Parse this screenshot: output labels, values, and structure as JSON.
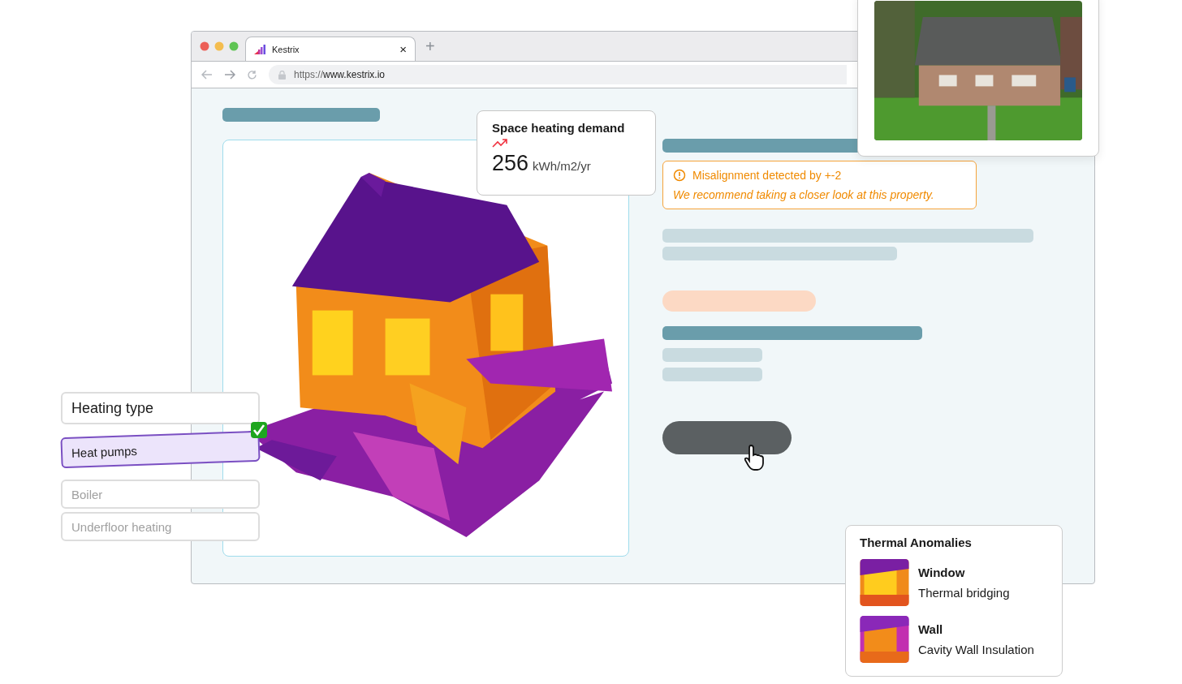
{
  "browser": {
    "tab": {
      "title": "Kestrix",
      "close": "×",
      "new_tab": "+",
      "selected": true
    },
    "url": {
      "scheme": "https://",
      "host": "www.kestrix.io"
    }
  },
  "metric": {
    "title": "Space heating demand",
    "value": "256",
    "unit": "kWh/m2/yr"
  },
  "alert": {
    "title": "Misalignment detected by +-2",
    "message": "We recommend taking a closer look at this property."
  },
  "heating": {
    "label": "Heating type",
    "options": [
      {
        "label": "Heat pumps",
        "selected": true
      },
      {
        "label": "Boiler",
        "selected": false
      },
      {
        "label": "Underfloor heating",
        "selected": false
      }
    ]
  },
  "anomalies": {
    "title": "Thermal Anomalies",
    "items": [
      {
        "name": "Window",
        "issue": "Thermal bridging"
      },
      {
        "name": "Wall",
        "issue": "Cavity Wall Insulation"
      }
    ]
  }
}
